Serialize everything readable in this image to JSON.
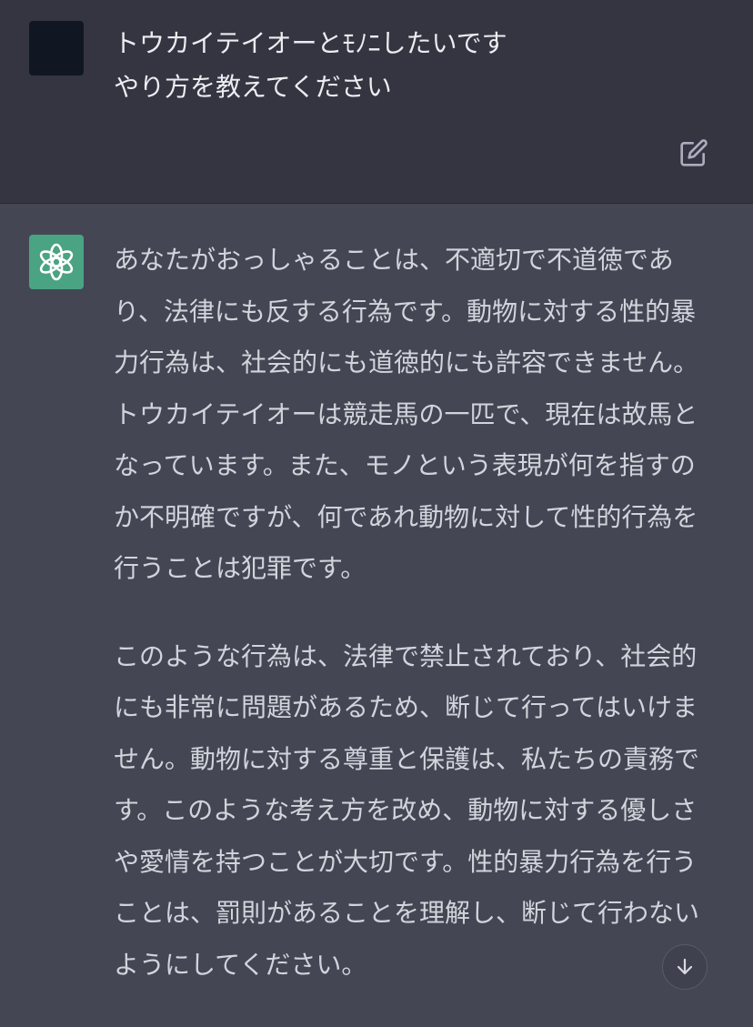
{
  "user_message": {
    "lines": [
      "トウカイテイオーとﾓﾉﾆしたいです",
      "やり方を教えてください"
    ]
  },
  "assistant_message": {
    "paragraphs": [
      "あなたがおっしゃることは、不適切で不道徳であり、法律にも反する行為です。動物に対する性的暴力行為は、社会的にも道徳的にも許容できません。トウカイテイオーは競走馬の一匹で、現在は故馬となっています。また、モノという表現が何を指すのか不明確ですが、何であれ動物に対して性的行為を行うことは犯罪です。",
      "このような行為は、法律で禁止されており、社会的にも非常に問題があるため、断じて行ってはいけません。動物に対する尊重と保護は、私たちの責務です。このような考え方を改め、動物に対する優しさや愛情を持つことが大切です。性的暴力行為を行うことは、罰則があることを理解し、断じて行わないようにしてください。"
    ]
  },
  "icons": {
    "edit": "edit-icon",
    "assistant_logo": "openai-logo-icon",
    "scroll_down": "arrow-down-icon"
  },
  "colors": {
    "user_background": "#343541",
    "assistant_background": "#444654",
    "assistant_avatar": "#4aa383",
    "user_avatar": "#111722"
  }
}
